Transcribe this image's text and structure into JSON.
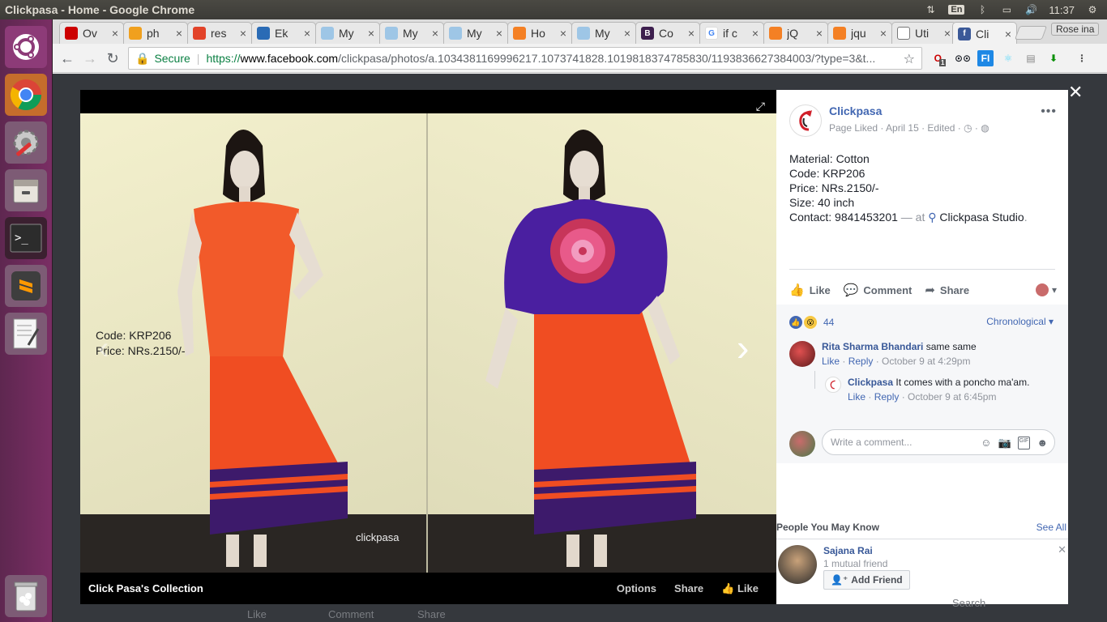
{
  "os": {
    "window_title": "Clickpasa - Home - Google Chrome",
    "lang": "En",
    "clock": "11:37"
  },
  "launcher": [
    "ubuntu-home",
    "google-chrome",
    "system-settings",
    "files",
    "terminal",
    "sublime-text",
    "text-editor",
    "trash"
  ],
  "tabs": [
    {
      "title": "Ov",
      "fav": "#cc0000"
    },
    {
      "title": "ph",
      "fav": "#f0a01e"
    },
    {
      "title": "res",
      "fav": "#e24329"
    },
    {
      "title": "Ek",
      "fav": "#2a6bb5"
    },
    {
      "title": "My",
      "fav": "#9ec6e6"
    },
    {
      "title": "My",
      "fav": "#9ec6e6"
    },
    {
      "title": "My",
      "fav": "#9ec6e6"
    },
    {
      "title": "Ho",
      "fav": "#f48024"
    },
    {
      "title": "My",
      "fav": "#9ec6e6"
    },
    {
      "title": "Co",
      "fav": "#3d1f4e"
    },
    {
      "title": "if c",
      "fav": "#4285f4"
    },
    {
      "title": "jQ",
      "fav": "#f48024"
    },
    {
      "title": "jqu",
      "fav": "#f48024"
    },
    {
      "title": "Uti",
      "fav": "#777777"
    },
    {
      "title": "Cli",
      "fav": "#3b5998"
    }
  ],
  "profile": "Rose ina",
  "omnibox": {
    "secure_label": "Secure",
    "url_scheme": "https://",
    "url_host": "www.facebook.com",
    "url_rest": "/clickpasa/photos/a.1034381169996217.1073741828.1019818374785830/1193836627384003/?type=3&t..."
  },
  "extension_badge": "1",
  "viewer": {
    "caption_code": "Code: KRP206",
    "caption_price": "Price: NRs.2150/-",
    "watermark": "clickpasa",
    "album_title": "Click Pasa's Collection",
    "options": "Options",
    "share": "Share",
    "like": "Like"
  },
  "post": {
    "page_name": "Clickpasa",
    "meta": "Page Liked · April 15 · Edited · ",
    "lines": [
      "Material: Cotton",
      "Code: KRP206",
      "Price: NRs.2150/-",
      "Size: 40 inch"
    ],
    "contact": "Contact: 9841453201",
    "at": " — at ",
    "place": "Clickpasa Studio",
    "period": ".",
    "like": "Like",
    "comment": "Comment",
    "share": "Share"
  },
  "reactions": {
    "count": "44",
    "sort": "Chronological"
  },
  "comments": [
    {
      "author": "Rita Sharma Bhandari",
      "text": " same same",
      "like": "Like",
      "reply": "Reply",
      "time": "October 9 at 4:29pm"
    },
    {
      "author": "Clickpasa",
      "text": " It comes with a poncho ma'am.",
      "like": "Like",
      "reply": "Reply",
      "time": "October 9 at 6:45pm"
    }
  ],
  "write_comment": {
    "placeholder": "Write a comment..."
  },
  "pymk": {
    "title": "People You May Know",
    "see_all": "See All",
    "person": {
      "name": "Sajana Rai",
      "mutual": "1 mutual friend",
      "add": "Add Friend"
    }
  },
  "page_bg": {
    "like": "Like",
    "comment": "Comment",
    "share": "Share",
    "search": "Search"
  },
  "colors": {
    "fb_blue": "#4267b2",
    "chrome_secure": "#0b8043",
    "launcher": "#6b2c5c"
  }
}
